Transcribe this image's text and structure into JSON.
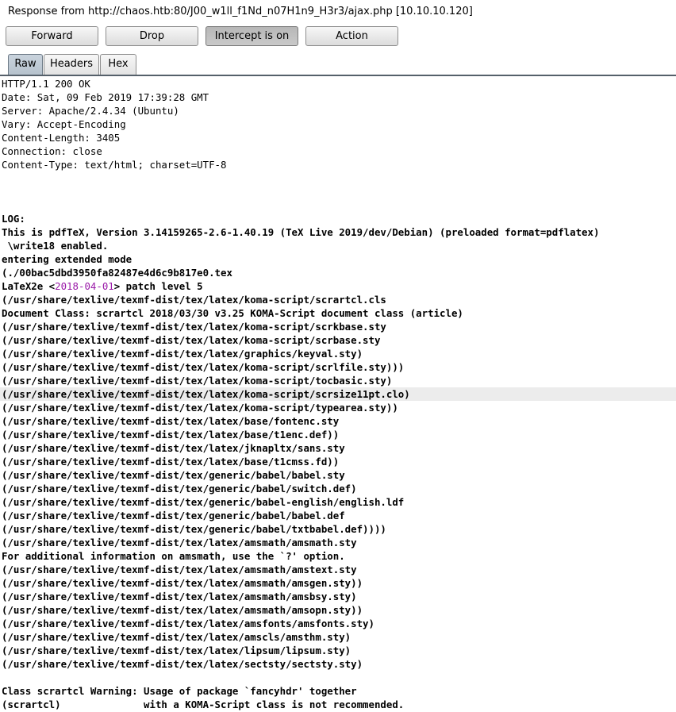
{
  "window": {
    "title": "Response from http://chaos.htb:80/J00_w1ll_f1Nd_n07H1n9_H3r3/ajax.php  [10.10.10.120]"
  },
  "toolbar": {
    "forward_label": "Forward",
    "drop_label": "Drop",
    "intercept_label": "Intercept is on",
    "action_label": "Action"
  },
  "tabs": [
    {
      "label": "Raw",
      "active": true
    },
    {
      "label": "Headers",
      "active": false
    },
    {
      "label": "Hex",
      "active": false
    }
  ],
  "headers": [
    "HTTP/1.1 200 OK",
    "Date: Sat, 09 Feb 2019 17:39:28 GMT",
    "Server: Apache/2.4.34 (Ubuntu)",
    "Vary: Accept-Encoding",
    "Content-Length: 3405",
    "Connection: close",
    "Content-Type: text/html; charset=UTF-8"
  ],
  "body": {
    "log_label": "LOG:",
    "line1": "This is pdfTeX, Version 3.14159265-2.6-1.40.19 (TeX Live 2019/dev/Debian) (preloaded format=pdflatex)",
    "line2": " \\write18 enabled.",
    "line3": "entering extended mode",
    "line4": "(./00bac5dbd3950fa82487e4d6c9b817e0.tex",
    "latex_prefix": "LaTeX2e <",
    "latex_date": "2018-04-01",
    "latex_suffix": "> patch level 5",
    "lines_a": [
      "(/usr/share/texlive/texmf-dist/tex/latex/koma-script/scrartcl.cls",
      "Document Class: scrartcl 2018/03/30 v3.25 KOMA-Script document class (article)",
      "(/usr/share/texlive/texmf-dist/tex/latex/koma-script/scrkbase.sty",
      "(/usr/share/texlive/texmf-dist/tex/latex/koma-script/scrbase.sty",
      "(/usr/share/texlive/texmf-dist/tex/latex/graphics/keyval.sty)",
      "(/usr/share/texlive/texmf-dist/tex/latex/koma-script/scrlfile.sty)))",
      "(/usr/share/texlive/texmf-dist/tex/latex/koma-script/tocbasic.sty)"
    ],
    "highlighted_line": "(/usr/share/texlive/texmf-dist/tex/latex/koma-script/scrsize11pt.clo)",
    "lines_b": [
      "(/usr/share/texlive/texmf-dist/tex/latex/koma-script/typearea.sty))",
      "(/usr/share/texlive/texmf-dist/tex/latex/base/fontenc.sty",
      "(/usr/share/texlive/texmf-dist/tex/latex/base/t1enc.def))",
      "(/usr/share/texlive/texmf-dist/tex/latex/jknapltx/sans.sty",
      "(/usr/share/texlive/texmf-dist/tex/latex/base/t1cmss.fd))",
      "(/usr/share/texlive/texmf-dist/tex/generic/babel/babel.sty",
      "(/usr/share/texlive/texmf-dist/tex/generic/babel/switch.def)",
      "(/usr/share/texlive/texmf-dist/tex/generic/babel-english/english.ldf",
      "(/usr/share/texlive/texmf-dist/tex/generic/babel/babel.def",
      "(/usr/share/texlive/texmf-dist/tex/generic/babel/txtbabel.def))))",
      "(/usr/share/texlive/texmf-dist/tex/latex/amsmath/amsmath.sty",
      "For additional information on amsmath, use the `?' option.",
      "(/usr/share/texlive/texmf-dist/tex/latex/amsmath/amstext.sty",
      "(/usr/share/texlive/texmf-dist/tex/latex/amsmath/amsgen.sty))",
      "(/usr/share/texlive/texmf-dist/tex/latex/amsmath/amsbsy.sty)",
      "(/usr/share/texlive/texmf-dist/tex/latex/amsmath/amsopn.sty))",
      "(/usr/share/texlive/texmf-dist/tex/latex/amsfonts/amsfonts.sty)",
      "(/usr/share/texlive/texmf-dist/tex/latex/amscls/amsthm.sty)",
      "(/usr/share/texlive/texmf-dist/tex/latex/lipsum/lipsum.sty)",
      "(/usr/share/texlive/texmf-dist/tex/latex/sectsty/sectsty.sty)"
    ],
    "warning_1": "Class scrartcl Warning: Usage of package `fancyhdr' together",
    "warning_2": "(scrartcl)              with a KOMA-Script class is not recommended."
  }
}
